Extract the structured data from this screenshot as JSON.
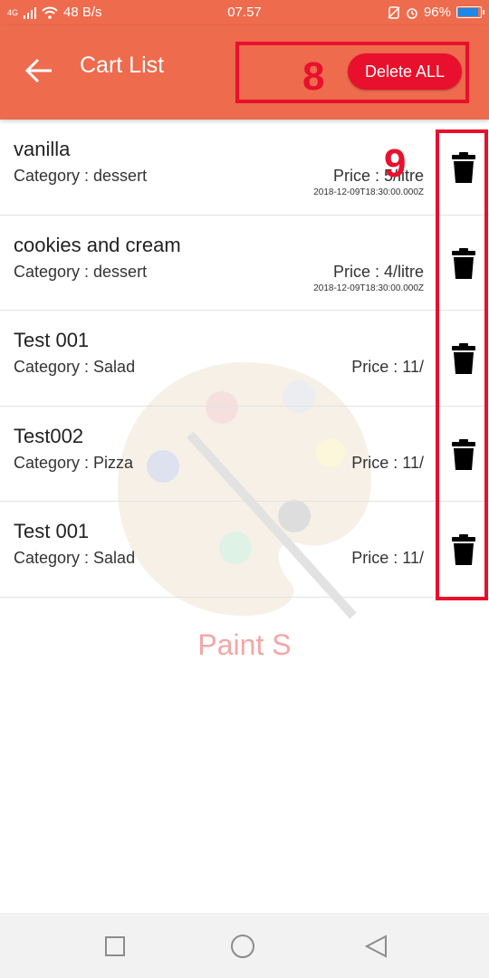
{
  "status_bar": {
    "network": "4G",
    "speed": "48 B/s",
    "time": "07.57",
    "battery": "96%",
    "battery_level": 0.96
  },
  "app_bar": {
    "title": "Cart List",
    "delete_all_label": "Delete ALL"
  },
  "annotations": {
    "delete_all_number": "8",
    "trash_column_number": "9"
  },
  "cart_items": [
    {
      "name": "vanilla",
      "category": "Category : dessert",
      "price": "Price : 5/litre",
      "date": "2018-12-09T18:30:00.000Z"
    },
    {
      "name": "cookies and cream",
      "category": "Category : dessert",
      "price": "Price : 4/litre",
      "date": "2018-12-09T18:30:00.000Z"
    },
    {
      "name": "Test 001",
      "category": "Category : Salad",
      "price": "Price : 11/",
      "date": ""
    },
    {
      "name": "Test002",
      "category": "Category : Pizza",
      "price": "Price : 11/",
      "date": ""
    },
    {
      "name": "Test 001",
      "category": "Category : Salad",
      "price": "Price : 11/",
      "date": ""
    }
  ],
  "watermark_text": "Paint S",
  "icons": {
    "back": "arrow-left-icon",
    "trash": "trash-icon",
    "nav_recent": "square-icon",
    "nav_home": "circle-icon",
    "nav_back": "triangle-back-icon"
  },
  "colors": {
    "app_bar": "#ee6b4d",
    "delete_button": "#e8102c",
    "annotation": "#e8102c"
  }
}
